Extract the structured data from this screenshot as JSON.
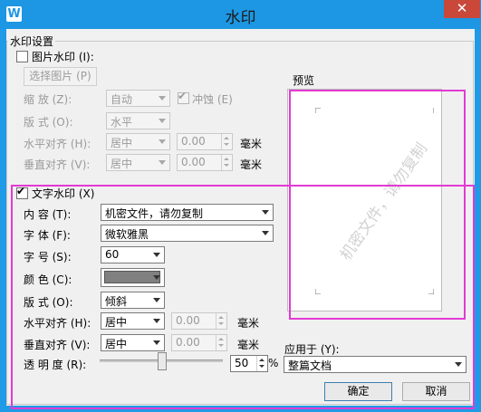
{
  "window": {
    "title": "水印",
    "close_glyph": "✕",
    "app_icon": "W"
  },
  "settings_group": {
    "label": "水印设置"
  },
  "picture_wm": {
    "checkbox_label": "图片水印 (I):",
    "checked": false,
    "choose_button": "选择图片 (P)",
    "zoom_label": "缩    放 (Z):",
    "zoom_value": "自动",
    "washout_label": "冲蚀 (E)",
    "washout_checked": true,
    "layout_label": "版    式 (O):",
    "layout_value": "水平",
    "h_align_label": "水平对齐 (H):",
    "h_align_value": "居中",
    "h_offset": "0.00",
    "h_unit": "毫米",
    "v_align_label": "垂直对齐 (V):",
    "v_align_value": "居中",
    "v_offset": "0.00",
    "v_unit": "毫米"
  },
  "text_wm": {
    "checkbox_label": "文字水印 (X)",
    "checked": true,
    "content_label": "内    容 (T):",
    "content_value": "机密文件，请勿复制",
    "font_label": "字    体 (F):",
    "font_value": "微软雅黑",
    "size_label": "字    号 (S):",
    "size_value": "60",
    "color_label": "颜    色 (C):",
    "color_value": "#808080",
    "layout_label": "版    式 (O):",
    "layout_value": "倾斜",
    "h_align_label": "水平对齐 (H):",
    "h_align_value": "居中",
    "h_offset": "0.00",
    "h_unit": "毫米",
    "v_align_label": "垂直对齐 (V):",
    "v_align_value": "居中",
    "v_offset": "0.00",
    "v_unit": "毫米",
    "transparency_label": "透 明 度 (R):",
    "transparency_value": "50",
    "transparency_unit": "%",
    "transparency_percent": 50
  },
  "preview": {
    "label": "预览",
    "watermark_text": "机密文件，请勿复制"
  },
  "apply": {
    "label": "应用于 (Y):",
    "value": "整篇文档"
  },
  "buttons": {
    "ok": "确定",
    "cancel": "取消"
  },
  "colors": {
    "titlebar": "#1d97e3",
    "close": "#c9483a",
    "highlight": "#e23ad3"
  }
}
